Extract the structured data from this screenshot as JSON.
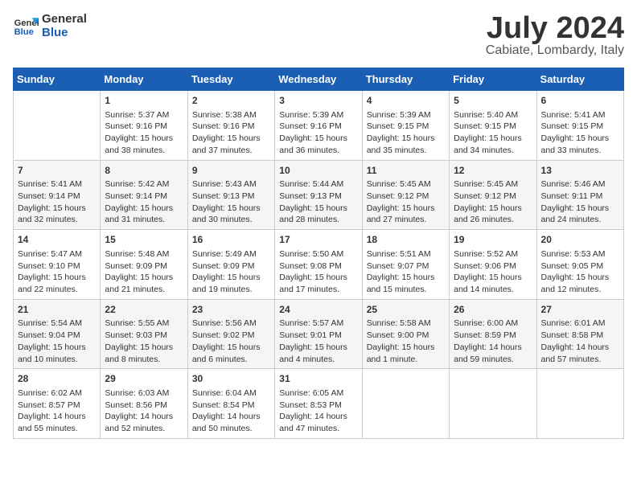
{
  "header": {
    "logo_line1": "General",
    "logo_line2": "Blue",
    "month": "July 2024",
    "location": "Cabiate, Lombardy, Italy"
  },
  "days_of_week": [
    "Sunday",
    "Monday",
    "Tuesday",
    "Wednesday",
    "Thursday",
    "Friday",
    "Saturday"
  ],
  "weeks": [
    [
      {
        "day": "",
        "info": ""
      },
      {
        "day": "1",
        "info": "Sunrise: 5:37 AM\nSunset: 9:16 PM\nDaylight: 15 hours\nand 38 minutes."
      },
      {
        "day": "2",
        "info": "Sunrise: 5:38 AM\nSunset: 9:16 PM\nDaylight: 15 hours\nand 37 minutes."
      },
      {
        "day": "3",
        "info": "Sunrise: 5:39 AM\nSunset: 9:16 PM\nDaylight: 15 hours\nand 36 minutes."
      },
      {
        "day": "4",
        "info": "Sunrise: 5:39 AM\nSunset: 9:15 PM\nDaylight: 15 hours\nand 35 minutes."
      },
      {
        "day": "5",
        "info": "Sunrise: 5:40 AM\nSunset: 9:15 PM\nDaylight: 15 hours\nand 34 minutes."
      },
      {
        "day": "6",
        "info": "Sunrise: 5:41 AM\nSunset: 9:15 PM\nDaylight: 15 hours\nand 33 minutes."
      }
    ],
    [
      {
        "day": "7",
        "info": "Sunrise: 5:41 AM\nSunset: 9:14 PM\nDaylight: 15 hours\nand 32 minutes."
      },
      {
        "day": "8",
        "info": "Sunrise: 5:42 AM\nSunset: 9:14 PM\nDaylight: 15 hours\nand 31 minutes."
      },
      {
        "day": "9",
        "info": "Sunrise: 5:43 AM\nSunset: 9:13 PM\nDaylight: 15 hours\nand 30 minutes."
      },
      {
        "day": "10",
        "info": "Sunrise: 5:44 AM\nSunset: 9:13 PM\nDaylight: 15 hours\nand 28 minutes."
      },
      {
        "day": "11",
        "info": "Sunrise: 5:45 AM\nSunset: 9:12 PM\nDaylight: 15 hours\nand 27 minutes."
      },
      {
        "day": "12",
        "info": "Sunrise: 5:45 AM\nSunset: 9:12 PM\nDaylight: 15 hours\nand 26 minutes."
      },
      {
        "day": "13",
        "info": "Sunrise: 5:46 AM\nSunset: 9:11 PM\nDaylight: 15 hours\nand 24 minutes."
      }
    ],
    [
      {
        "day": "14",
        "info": "Sunrise: 5:47 AM\nSunset: 9:10 PM\nDaylight: 15 hours\nand 22 minutes."
      },
      {
        "day": "15",
        "info": "Sunrise: 5:48 AM\nSunset: 9:09 PM\nDaylight: 15 hours\nand 21 minutes."
      },
      {
        "day": "16",
        "info": "Sunrise: 5:49 AM\nSunset: 9:09 PM\nDaylight: 15 hours\nand 19 minutes."
      },
      {
        "day": "17",
        "info": "Sunrise: 5:50 AM\nSunset: 9:08 PM\nDaylight: 15 hours\nand 17 minutes."
      },
      {
        "day": "18",
        "info": "Sunrise: 5:51 AM\nSunset: 9:07 PM\nDaylight: 15 hours\nand 15 minutes."
      },
      {
        "day": "19",
        "info": "Sunrise: 5:52 AM\nSunset: 9:06 PM\nDaylight: 15 hours\nand 14 minutes."
      },
      {
        "day": "20",
        "info": "Sunrise: 5:53 AM\nSunset: 9:05 PM\nDaylight: 15 hours\nand 12 minutes."
      }
    ],
    [
      {
        "day": "21",
        "info": "Sunrise: 5:54 AM\nSunset: 9:04 PM\nDaylight: 15 hours\nand 10 minutes."
      },
      {
        "day": "22",
        "info": "Sunrise: 5:55 AM\nSunset: 9:03 PM\nDaylight: 15 hours\nand 8 minutes."
      },
      {
        "day": "23",
        "info": "Sunrise: 5:56 AM\nSunset: 9:02 PM\nDaylight: 15 hours\nand 6 minutes."
      },
      {
        "day": "24",
        "info": "Sunrise: 5:57 AM\nSunset: 9:01 PM\nDaylight: 15 hours\nand 4 minutes."
      },
      {
        "day": "25",
        "info": "Sunrise: 5:58 AM\nSunset: 9:00 PM\nDaylight: 15 hours\nand 1 minute."
      },
      {
        "day": "26",
        "info": "Sunrise: 6:00 AM\nSunset: 8:59 PM\nDaylight: 14 hours\nand 59 minutes."
      },
      {
        "day": "27",
        "info": "Sunrise: 6:01 AM\nSunset: 8:58 PM\nDaylight: 14 hours\nand 57 minutes."
      }
    ],
    [
      {
        "day": "28",
        "info": "Sunrise: 6:02 AM\nSunset: 8:57 PM\nDaylight: 14 hours\nand 55 minutes."
      },
      {
        "day": "29",
        "info": "Sunrise: 6:03 AM\nSunset: 8:56 PM\nDaylight: 14 hours\nand 52 minutes."
      },
      {
        "day": "30",
        "info": "Sunrise: 6:04 AM\nSunset: 8:54 PM\nDaylight: 14 hours\nand 50 minutes."
      },
      {
        "day": "31",
        "info": "Sunrise: 6:05 AM\nSunset: 8:53 PM\nDaylight: 14 hours\nand 47 minutes."
      },
      {
        "day": "",
        "info": ""
      },
      {
        "day": "",
        "info": ""
      },
      {
        "day": "",
        "info": ""
      }
    ]
  ]
}
